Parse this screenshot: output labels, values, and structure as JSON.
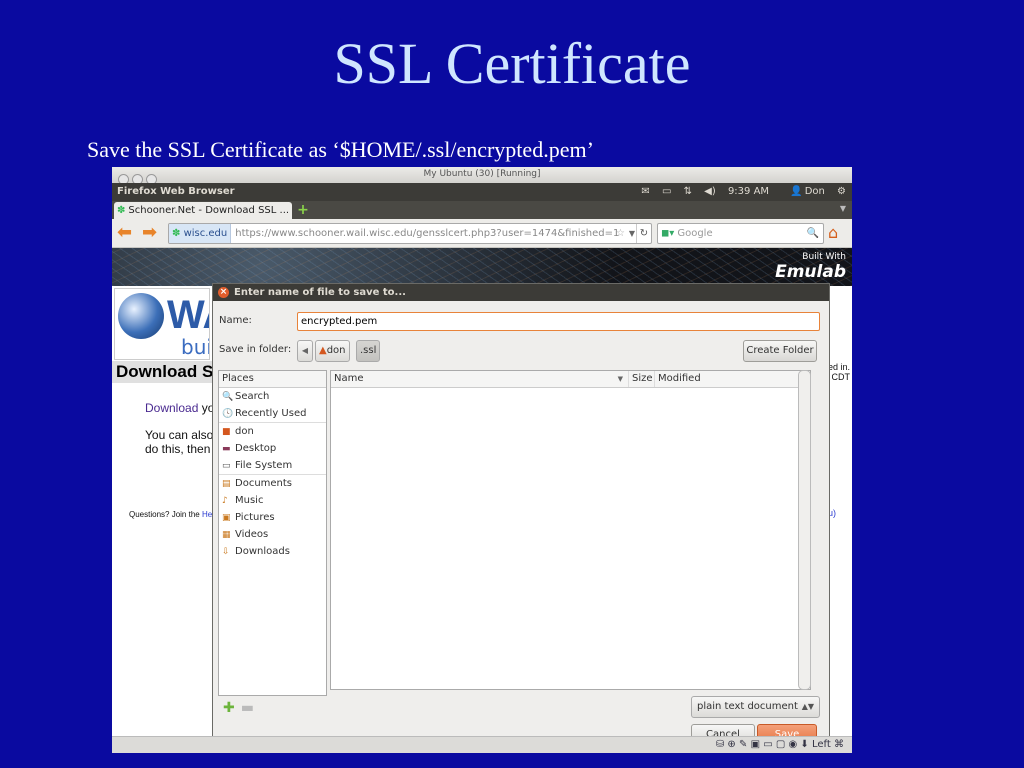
{
  "slide": {
    "title": "SSL Certificate",
    "subtitle": "Save the SSL Certificate as ‘$HOME/.ssl/encrypted.pem’"
  },
  "vm_window": {
    "title": "My Ubuntu (30) [Running]",
    "status_host_key": "Left ⌘"
  },
  "top_panel": {
    "app_name": "Firefox Web Browser",
    "time": "9:39 AM",
    "user": "Don"
  },
  "browser": {
    "tab_title": "Schooner.Net - Download SSL ...",
    "site_badge": "wisc.edu",
    "url": "https://www.schooner.wail.wisc.edu/gensslcert.php3?user=1474&finished=1",
    "search_placeholder": "Google"
  },
  "page": {
    "banner_built_with": "Built With",
    "banner_brand": "Emulab",
    "logo_fragment": "WA",
    "logo_sub": "bui",
    "heading_fragment": "Download S",
    "download_link": "Download",
    "download_rest": " yo",
    "line2": "You can also",
    "line3": "do this, then",
    "footer_prefix": "Questions? Join the ",
    "footer_link": "Hel",
    "right_line1": "ed in.",
    "right_line2": "CDT",
    "right_footer": "lu)"
  },
  "save_dialog": {
    "title": "Enter name of file to save to...",
    "name_label": "Name:",
    "name_value": "encrypted.pem",
    "folder_label": "Save in folder:",
    "breadcrumb": [
      "don",
      ".ssl"
    ],
    "create_folder": "Create Folder",
    "places_header": "Places",
    "places_group1": [
      "Search",
      "Recently Used"
    ],
    "places_group2": [
      "don",
      "Desktop",
      "File System"
    ],
    "places_group3": [
      "Documents",
      "Music",
      "Pictures",
      "Videos",
      "Downloads"
    ],
    "col_name": "Name",
    "col_size": "Size",
    "col_modified": "Modified",
    "filter_value": "plain text document",
    "cancel_label": "Cancel",
    "save_label": "Save"
  },
  "colors": {
    "slide_bg": "#0a0aa0",
    "title_color": "#cfe6ff",
    "ubuntu_panel": "#3c3b37",
    "accent_orange": "#e8833a"
  }
}
